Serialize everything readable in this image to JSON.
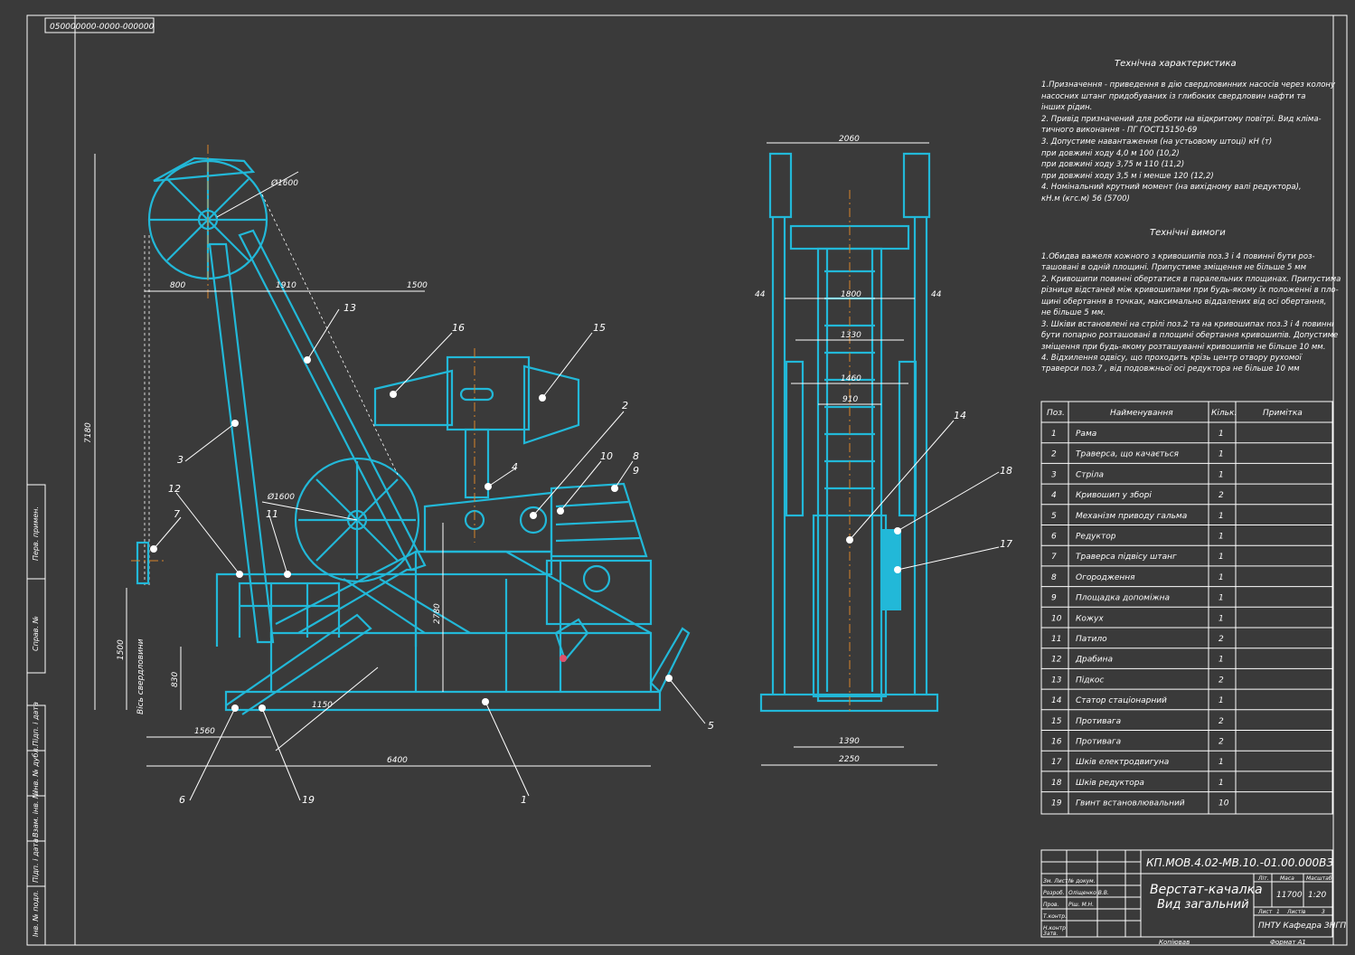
{
  "drawing_code_stamp": "050000000-0000-000000",
  "dimensions": {
    "d1": "Ø1600",
    "d2": "Ø1600",
    "w800": "800",
    "w1910": "1910",
    "w1500": "1500",
    "h7180": "7180",
    "h1500": "1500",
    "h830": "830",
    "h2780": "2780",
    "w1560": "1560",
    "w6400": "6400",
    "diag1150": "1150",
    "well_axis": "Вісь свердловини",
    "s2060": "2060",
    "s1800": "1800",
    "s1330": "1330",
    "s1460": "1460",
    "s910": "910",
    "s44a": "44",
    "s44b": "44",
    "s1390": "1390",
    "s2250": "2250"
  },
  "callouts": [
    "1",
    "2",
    "3",
    "4",
    "5",
    "6",
    "7",
    "8",
    "9",
    "10",
    "11",
    "12",
    "13",
    "14",
    "15",
    "16",
    "17",
    "18",
    "19"
  ],
  "tech_char": {
    "title": "Технічна характеристика",
    "lines": [
      "1.Призначення - приведення в дію свердловинних насосів через колону",
      "насосних штанг придобуваних із глибоких свердловин нафти та",
      "інших рідин.",
      "2. Привід призначений для роботи на відкритому повітрі. Вид кліма-",
      "тичного виконання - ПГ ГОСТ15150-69",
      "3. Допустиме навантаження (на устьовому штоці)           кН (т)",
      "при довжині ходу 4,0 м                                   100 (10,2)",
      "при довжині ходу 3,75 м                                  110 (11,2)",
      "при довжині ходу 3,5 м і менше                           120 (12,2)",
      "4. Номінальний крутний момент (на вихідному валі редуктора),",
      "кН.м (кгс.м)                                              56 (5700)"
    ]
  },
  "tech_req": {
    "title": "Технічні вимоги",
    "lines": [
      "1.Обидва важеля кожного з кривошипів поз.3 і 4 повинні бути роз-",
      "ташовані в одній площині. Припустиме зміщення не більше 5 мм",
      "2. Кривошипи повинні обертатися в паралельних площинах. Припустима",
      "різниця відстаней між кривошипами при будь-якому їх положенні в пло-",
      "   щині обертання в точках, максимально віддалених від осі обертання,",
      "не більше 5 мм.",
      "3. Шківи встановлені на стрілі поз.2 та на кривошипах поз.3 і 4 повинні",
      "бути попарно розташовані в площині обертання кривошипів. Допустиме",
      "зміщення при будь-якому розташуванні кривошипів не більше 10 мм.",
      "4. Відхилення одвісу, що проходить крізь центр отвору рухомої",
      "траверси поз.7 , від подовжньої осі редуктора не більше 10 мм"
    ]
  },
  "parts_table": {
    "headers": [
      "Поз.",
      "Найменування",
      "Кільк.",
      "Примітка"
    ],
    "rows": [
      [
        "1",
        "Рама",
        "1",
        ""
      ],
      [
        "2",
        "Траверса, що качається",
        "1",
        ""
      ],
      [
        "3",
        "Стріла",
        "1",
        ""
      ],
      [
        "4",
        "Кривошип у зборі",
        "2",
        ""
      ],
      [
        "5",
        "Механізм приводу гальма",
        "1",
        ""
      ],
      [
        "6",
        "Редуктор",
        "1",
        ""
      ],
      [
        "7",
        "Траверса підвісу штанг",
        "1",
        ""
      ],
      [
        "8",
        "Огородження",
        "1",
        ""
      ],
      [
        "9",
        "Площадка допоміжна",
        "1",
        ""
      ],
      [
        "10",
        "Кожух",
        "1",
        ""
      ],
      [
        "11",
        "Патило",
        "2",
        ""
      ],
      [
        "12",
        "Драбина",
        "1",
        ""
      ],
      [
        "13",
        "Підкос",
        "2",
        ""
      ],
      [
        "14",
        "Статор стаціонарний",
        "1",
        ""
      ],
      [
        "15",
        "Противага",
        "2",
        ""
      ],
      [
        "16",
        "Противага",
        "2",
        ""
      ],
      [
        "17",
        "Шків електродвигуна",
        "1",
        ""
      ],
      [
        "18",
        "Шків редуктора",
        "1",
        ""
      ],
      [
        "19",
        "Гвинт встановлювальний",
        "10",
        ""
      ]
    ]
  },
  "title_block": {
    "doc_code": "КП.МОВ.4.02-МВ.10.-01.00.000ВЗ",
    "name_line1": "Верстат-качалка",
    "name_line2": "Вид загальний",
    "lit_label": "Літ.",
    "mass_label": "Маса",
    "scale_label": "Масштаб",
    "mass": "11700",
    "scale": "1:20",
    "sheet_label": "Лист",
    "sheet_num": "1",
    "sheets_label": "Листів",
    "sheets_num": "3",
    "org": "ПНТУ Кафедра ЗНГП",
    "roles": [
      "Зм. Лист",
      "Розроб.",
      "Пров.",
      "Т.контр.",
      "Н.контр.",
      "Затв."
    ],
    "names": [
      "№ докум.",
      "Оліщенко В.В.",
      "Ріш. М.Н.",
      "",
      "",
      ""
    ],
    "copied": "Копіював",
    "format": "Формат   А1"
  },
  "left_strip": [
    "Перв. примен.",
    "Справ. №",
    "Підп. і дата",
    "Інв. № дубл.",
    "Взам. інв. №",
    "Підп. і дата",
    "Інв. № подл."
  ]
}
